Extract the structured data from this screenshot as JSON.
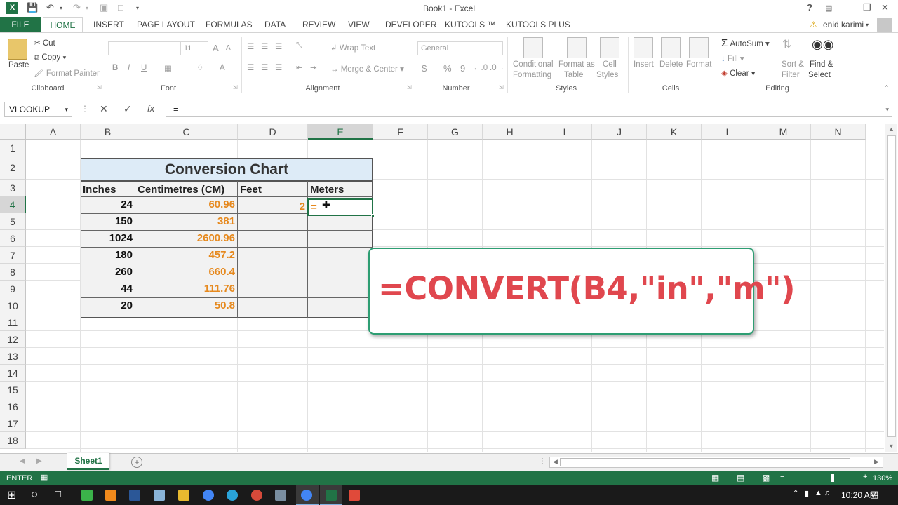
{
  "window": {
    "title": "Book1 - Excel",
    "help": "?",
    "minimize": "—",
    "restore": "❐",
    "close": "✕"
  },
  "account": {
    "user": "enid karimi"
  },
  "tabs": [
    "FILE",
    "HOME",
    "INSERT",
    "PAGE LAYOUT",
    "FORMULAS",
    "DATA",
    "REVIEW",
    "VIEW",
    "DEVELOPER",
    "KUTOOLS ™",
    "KUTOOLS PLUS"
  ],
  "ribbon": {
    "clipboard": {
      "paste": "Paste",
      "cut": "Cut",
      "copy": "Copy",
      "format_painter": "Format Painter",
      "label": "Clipboard"
    },
    "font": {
      "size": "11",
      "bold": "B",
      "italic": "I",
      "underline": "U",
      "grow": "A",
      "shrink": "A",
      "color": "A",
      "label": "Font"
    },
    "alignment": {
      "wrap_text": "Wrap Text",
      "merge_center": "Merge & Center",
      "label": "Alignment"
    },
    "number": {
      "format": "General",
      "currency": "$",
      "percent": "%",
      "comma": "9",
      "label": "Number"
    },
    "styles": {
      "conditional_1": "Conditional",
      "conditional_2": "Formatting",
      "format_table_1": "Format as",
      "format_table_2": "Table",
      "cell_styles_1": "Cell",
      "cell_styles_2": "Styles",
      "label": "Styles"
    },
    "cells": {
      "insert": "Insert",
      "delete": "Delete",
      "format": "Format",
      "label": "Cells"
    },
    "editing": {
      "autosum": "AutoSum",
      "fill": "Fill",
      "clear": "Clear",
      "sort_1": "Sort &",
      "sort_2": "Filter",
      "find_1": "Find &",
      "find_2": "Select",
      "label": "Editing"
    }
  },
  "formula_bar": {
    "name_box": "VLOOKUP",
    "cancel": "✕",
    "enter": "✓",
    "fx": "fx",
    "formula": "="
  },
  "columns": [
    "A",
    "B",
    "C",
    "D",
    "E",
    "F",
    "G",
    "H",
    "I",
    "J",
    "K",
    "L",
    "M",
    "N"
  ],
  "rows": [
    "1",
    "2",
    "3",
    "4",
    "5",
    "6",
    "7",
    "8",
    "9",
    "10",
    "11",
    "12",
    "13",
    "14",
    "15",
    "16",
    "17",
    "18"
  ],
  "table": {
    "title": "Conversion Chart",
    "headers": [
      "Inches",
      "Centimetres (CM)",
      "Feet",
      "Meters"
    ],
    "inches": [
      "24",
      "150",
      "1024",
      "180",
      "260",
      "44",
      "20"
    ],
    "cm": [
      "60.96",
      "381",
      "2600.96",
      "457.2",
      "660.4",
      "111.76",
      "50.8"
    ],
    "feet_d4": "2",
    "meters_e4": "="
  },
  "callout": "=CONVERT(B4,\"in\",\"m\")",
  "sheets": {
    "active": "Sheet1",
    "add": "+"
  },
  "status": {
    "mode": "ENTER",
    "zoom": "130%"
  },
  "taskbar": {
    "time": "10:20 AM"
  },
  "colors": {
    "excel_green": "#217346",
    "header_blue": "#ddebf7",
    "orange": "#e6891e",
    "callout_red": "#e0474e",
    "callout_border": "#2e9e73"
  }
}
